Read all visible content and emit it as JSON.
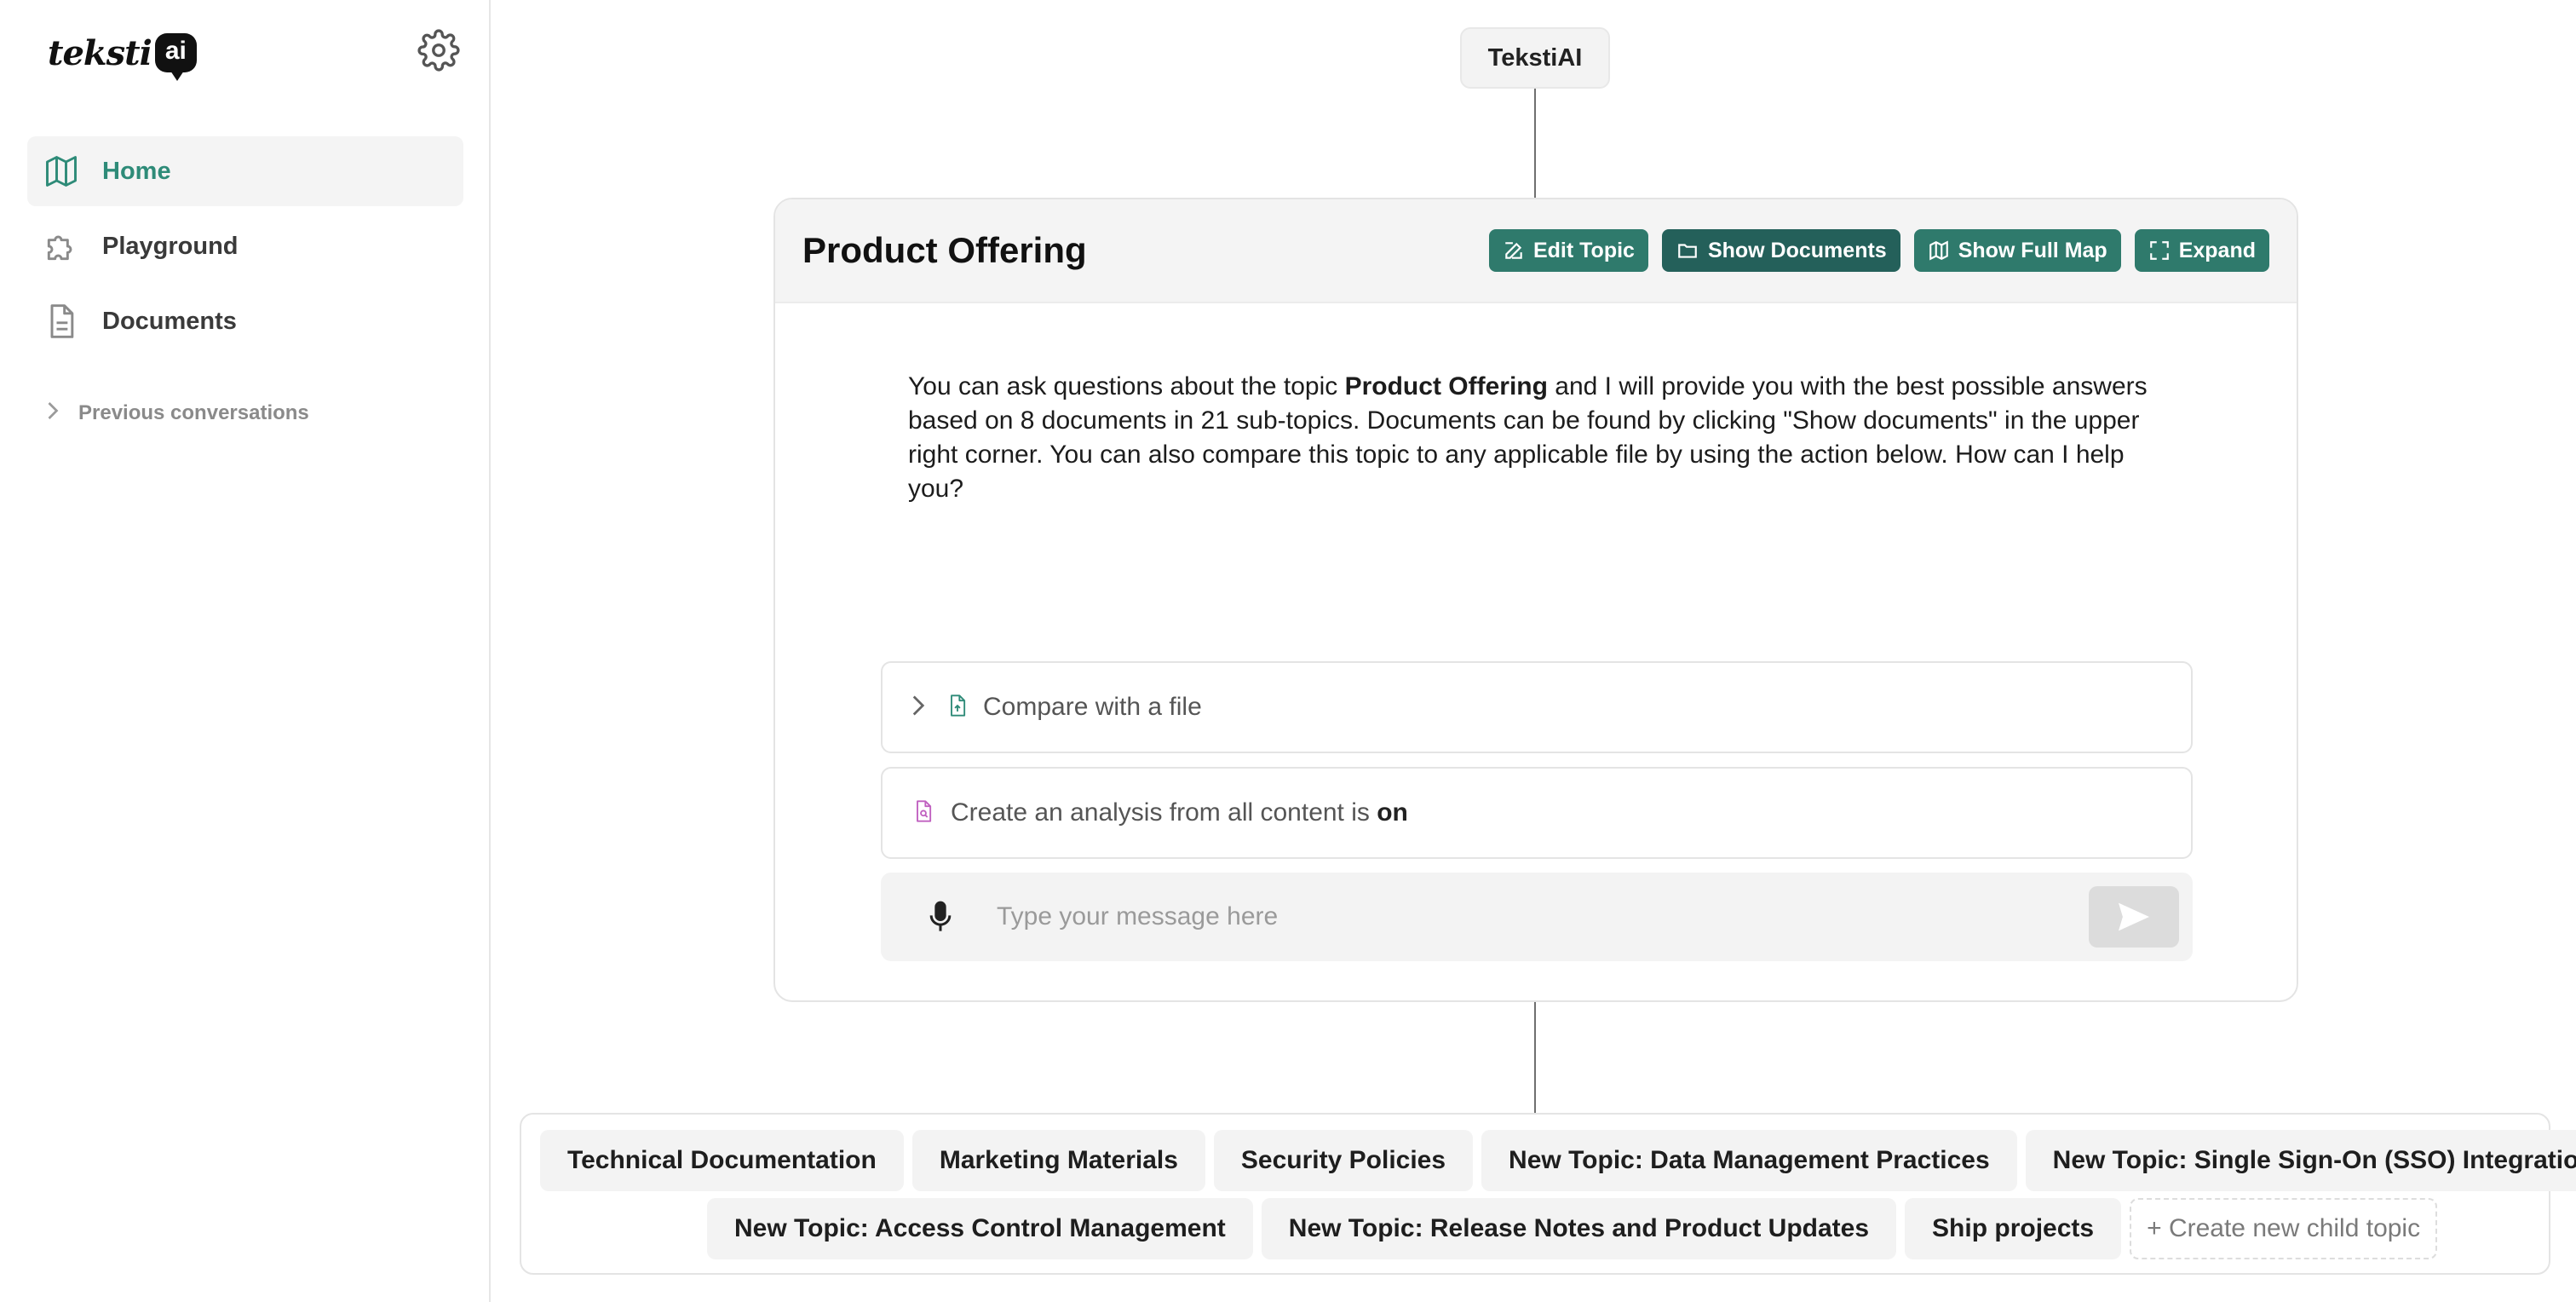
{
  "sidebar": {
    "logo": {
      "word": "teksti",
      "badge": "ai"
    },
    "items": [
      {
        "label": "Home",
        "icon": "map-icon",
        "active": true
      },
      {
        "label": "Playground",
        "icon": "puzzle-icon",
        "active": false
      },
      {
        "label": "Documents",
        "icon": "document-icon",
        "active": false
      }
    ],
    "previous_conversations": "Previous conversations"
  },
  "root_node": "TekstiAI",
  "topic": {
    "title": "Product Offering",
    "buttons": {
      "edit": "Edit Topic",
      "show_documents": "Show Documents",
      "show_full_map": "Show Full Map",
      "expand": "Expand"
    },
    "intro": {
      "before": "You can ask questions about the topic ",
      "topic_bold": "Product Offering",
      "after": " and I will provide you with the best possible answers based on 8 documents in 21 sub-topics. Documents can be found by clicking \"Show documents\" in the upper right corner. You can also compare this topic to any applicable file by using the action below. How can I help you?"
    },
    "compare_label": "Compare with a file",
    "analysis": {
      "text": "Create an analysis from all content is ",
      "state": "on"
    },
    "message": {
      "placeholder": "Type your message here",
      "value": ""
    }
  },
  "children": {
    "row1": [
      "Technical Documentation",
      "Marketing Materials",
      "Security Policies",
      "New Topic: Data Management Practices",
      "New Topic: Single Sign-On (SSO) Integration"
    ],
    "row2": [
      "New Topic: Access Control Management",
      "New Topic: Release Notes and Product Updates",
      "Ship projects"
    ],
    "create_new": "+ Create new child topic"
  },
  "colors": {
    "accent": "#2f7a6c",
    "accent_dark": "#24605a",
    "active_nav": "#2e8b78"
  }
}
